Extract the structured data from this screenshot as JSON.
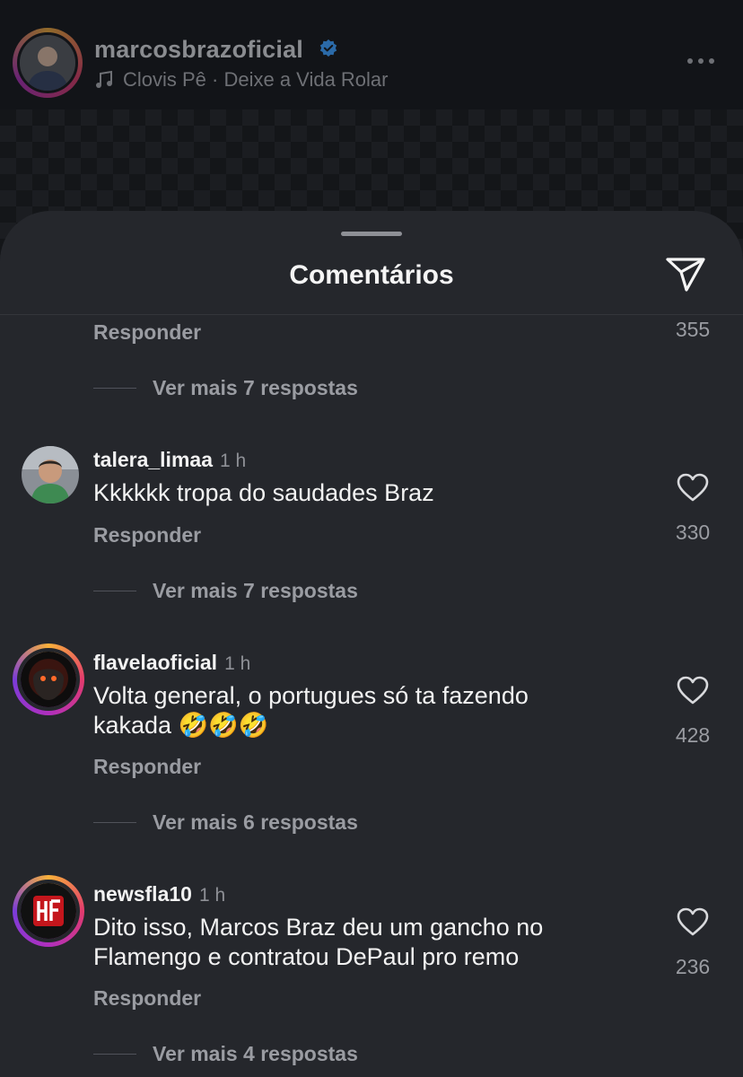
{
  "post": {
    "username": "marcosbrazoficial",
    "music": "Clovis Pê · Deixe a Vida Rolar"
  },
  "sheet": {
    "title": "Comentários",
    "share_icon": "send-icon"
  },
  "top_partial": {
    "reply_label": "Responder",
    "likes": "355",
    "more_replies": "Ver mais 7 respostas"
  },
  "comments": [
    {
      "username": "talera_limaa",
      "time": "1 h",
      "text_lines": [
        "Kkkkkk tropa do saudades Braz"
      ],
      "likes": "330",
      "reply_label": "Responder",
      "more_replies": "Ver mais 7 respostas"
    },
    {
      "username": "flavelaoficial",
      "time": "1 h",
      "text_lines": [
        "Volta general, o portugues só ta fazendo",
        "kakada 🤣🤣🤣"
      ],
      "likes": "428",
      "reply_label": "Responder",
      "more_replies": "Ver mais 6 respostas"
    },
    {
      "username": "newsfla10",
      "time": "1 h",
      "text_lines": [
        "Dito isso, Marcos Braz deu um gancho no",
        "Flamengo e contratou DePaul pro remo"
      ],
      "likes": "236",
      "reply_label": "Responder",
      "more_replies": "Ver mais 4 respostas"
    }
  ],
  "colors": {
    "sheet_bg": "#25272c",
    "verified": "#3897f0",
    "story_ring_start": "#f9b13a",
    "story_ring_end": "#b02fbe"
  }
}
